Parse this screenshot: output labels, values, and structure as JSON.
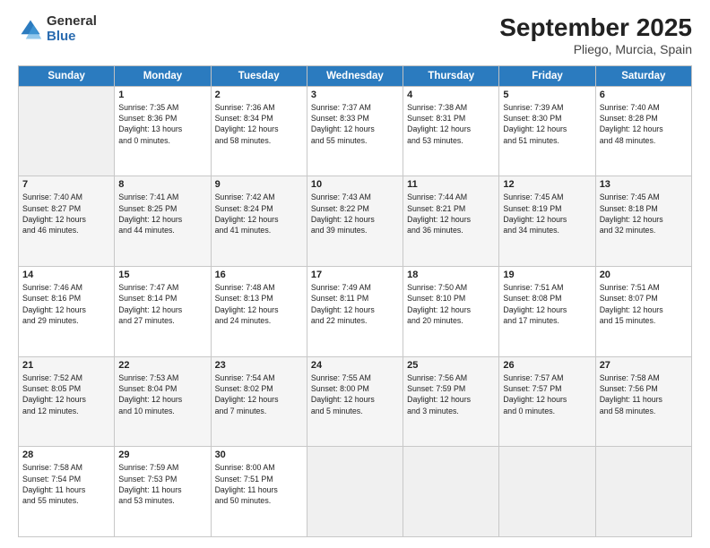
{
  "logo": {
    "general": "General",
    "blue": "Blue"
  },
  "title": "September 2025",
  "subtitle": "Pliego, Murcia, Spain",
  "days_of_week": [
    "Sunday",
    "Monday",
    "Tuesday",
    "Wednesday",
    "Thursday",
    "Friday",
    "Saturday"
  ],
  "weeks": [
    [
      {
        "day": "",
        "lines": []
      },
      {
        "day": "1",
        "lines": [
          "Sunrise: 7:35 AM",
          "Sunset: 8:36 PM",
          "Daylight: 13 hours",
          "and 0 minutes."
        ]
      },
      {
        "day": "2",
        "lines": [
          "Sunrise: 7:36 AM",
          "Sunset: 8:34 PM",
          "Daylight: 12 hours",
          "and 58 minutes."
        ]
      },
      {
        "day": "3",
        "lines": [
          "Sunrise: 7:37 AM",
          "Sunset: 8:33 PM",
          "Daylight: 12 hours",
          "and 55 minutes."
        ]
      },
      {
        "day": "4",
        "lines": [
          "Sunrise: 7:38 AM",
          "Sunset: 8:31 PM",
          "Daylight: 12 hours",
          "and 53 minutes."
        ]
      },
      {
        "day": "5",
        "lines": [
          "Sunrise: 7:39 AM",
          "Sunset: 8:30 PM",
          "Daylight: 12 hours",
          "and 51 minutes."
        ]
      },
      {
        "day": "6",
        "lines": [
          "Sunrise: 7:40 AM",
          "Sunset: 8:28 PM",
          "Daylight: 12 hours",
          "and 48 minutes."
        ]
      }
    ],
    [
      {
        "day": "7",
        "lines": [
          "Sunrise: 7:40 AM",
          "Sunset: 8:27 PM",
          "Daylight: 12 hours",
          "and 46 minutes."
        ]
      },
      {
        "day": "8",
        "lines": [
          "Sunrise: 7:41 AM",
          "Sunset: 8:25 PM",
          "Daylight: 12 hours",
          "and 44 minutes."
        ]
      },
      {
        "day": "9",
        "lines": [
          "Sunrise: 7:42 AM",
          "Sunset: 8:24 PM",
          "Daylight: 12 hours",
          "and 41 minutes."
        ]
      },
      {
        "day": "10",
        "lines": [
          "Sunrise: 7:43 AM",
          "Sunset: 8:22 PM",
          "Daylight: 12 hours",
          "and 39 minutes."
        ]
      },
      {
        "day": "11",
        "lines": [
          "Sunrise: 7:44 AM",
          "Sunset: 8:21 PM",
          "Daylight: 12 hours",
          "and 36 minutes."
        ]
      },
      {
        "day": "12",
        "lines": [
          "Sunrise: 7:45 AM",
          "Sunset: 8:19 PM",
          "Daylight: 12 hours",
          "and 34 minutes."
        ]
      },
      {
        "day": "13",
        "lines": [
          "Sunrise: 7:45 AM",
          "Sunset: 8:18 PM",
          "Daylight: 12 hours",
          "and 32 minutes."
        ]
      }
    ],
    [
      {
        "day": "14",
        "lines": [
          "Sunrise: 7:46 AM",
          "Sunset: 8:16 PM",
          "Daylight: 12 hours",
          "and 29 minutes."
        ]
      },
      {
        "day": "15",
        "lines": [
          "Sunrise: 7:47 AM",
          "Sunset: 8:14 PM",
          "Daylight: 12 hours",
          "and 27 minutes."
        ]
      },
      {
        "day": "16",
        "lines": [
          "Sunrise: 7:48 AM",
          "Sunset: 8:13 PM",
          "Daylight: 12 hours",
          "and 24 minutes."
        ]
      },
      {
        "day": "17",
        "lines": [
          "Sunrise: 7:49 AM",
          "Sunset: 8:11 PM",
          "Daylight: 12 hours",
          "and 22 minutes."
        ]
      },
      {
        "day": "18",
        "lines": [
          "Sunrise: 7:50 AM",
          "Sunset: 8:10 PM",
          "Daylight: 12 hours",
          "and 20 minutes."
        ]
      },
      {
        "day": "19",
        "lines": [
          "Sunrise: 7:51 AM",
          "Sunset: 8:08 PM",
          "Daylight: 12 hours",
          "and 17 minutes."
        ]
      },
      {
        "day": "20",
        "lines": [
          "Sunrise: 7:51 AM",
          "Sunset: 8:07 PM",
          "Daylight: 12 hours",
          "and 15 minutes."
        ]
      }
    ],
    [
      {
        "day": "21",
        "lines": [
          "Sunrise: 7:52 AM",
          "Sunset: 8:05 PM",
          "Daylight: 12 hours",
          "and 12 minutes."
        ]
      },
      {
        "day": "22",
        "lines": [
          "Sunrise: 7:53 AM",
          "Sunset: 8:04 PM",
          "Daylight: 12 hours",
          "and 10 minutes."
        ]
      },
      {
        "day": "23",
        "lines": [
          "Sunrise: 7:54 AM",
          "Sunset: 8:02 PM",
          "Daylight: 12 hours",
          "and 7 minutes."
        ]
      },
      {
        "day": "24",
        "lines": [
          "Sunrise: 7:55 AM",
          "Sunset: 8:00 PM",
          "Daylight: 12 hours",
          "and 5 minutes."
        ]
      },
      {
        "day": "25",
        "lines": [
          "Sunrise: 7:56 AM",
          "Sunset: 7:59 PM",
          "Daylight: 12 hours",
          "and 3 minutes."
        ]
      },
      {
        "day": "26",
        "lines": [
          "Sunrise: 7:57 AM",
          "Sunset: 7:57 PM",
          "Daylight: 12 hours",
          "and 0 minutes."
        ]
      },
      {
        "day": "27",
        "lines": [
          "Sunrise: 7:58 AM",
          "Sunset: 7:56 PM",
          "Daylight: 11 hours",
          "and 58 minutes."
        ]
      }
    ],
    [
      {
        "day": "28",
        "lines": [
          "Sunrise: 7:58 AM",
          "Sunset: 7:54 PM",
          "Daylight: 11 hours",
          "and 55 minutes."
        ]
      },
      {
        "day": "29",
        "lines": [
          "Sunrise: 7:59 AM",
          "Sunset: 7:53 PM",
          "Daylight: 11 hours",
          "and 53 minutes."
        ]
      },
      {
        "day": "30",
        "lines": [
          "Sunrise: 8:00 AM",
          "Sunset: 7:51 PM",
          "Daylight: 11 hours",
          "and 50 minutes."
        ]
      },
      {
        "day": "",
        "lines": []
      },
      {
        "day": "",
        "lines": []
      },
      {
        "day": "",
        "lines": []
      },
      {
        "day": "",
        "lines": []
      }
    ]
  ]
}
